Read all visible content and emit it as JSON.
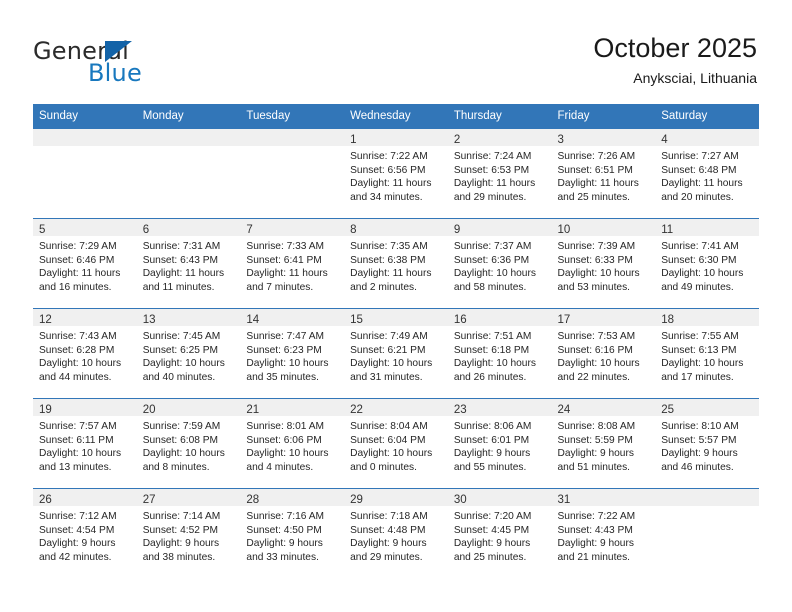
{
  "brand": {
    "name_top": "General",
    "name_bottom": "Blue",
    "accent_color": "#1878be",
    "triangle_color": "#1363a8"
  },
  "header": {
    "title": "October 2025",
    "subtitle": "Anyksciai, Lithuania"
  },
  "calendar": {
    "header_color": "#3276b8",
    "weekday_headers": [
      "Sunday",
      "Monday",
      "Tuesday",
      "Wednesday",
      "Thursday",
      "Friday",
      "Saturday"
    ],
    "labels": {
      "sunrise": "Sunrise:",
      "sunset": "Sunset:",
      "daylight": "Daylight:"
    },
    "weeks": [
      [
        {
          "day": "",
          "sunrise": "",
          "sunset": "",
          "daylight": ""
        },
        {
          "day": "",
          "sunrise": "",
          "sunset": "",
          "daylight": ""
        },
        {
          "day": "",
          "sunrise": "",
          "sunset": "",
          "daylight": ""
        },
        {
          "day": "1",
          "sunrise": "Sunrise: 7:22 AM",
          "sunset": "Sunset: 6:56 PM",
          "daylight": "Daylight: 11 hours and 34 minutes."
        },
        {
          "day": "2",
          "sunrise": "Sunrise: 7:24 AM",
          "sunset": "Sunset: 6:53 PM",
          "daylight": "Daylight: 11 hours and 29 minutes."
        },
        {
          "day": "3",
          "sunrise": "Sunrise: 7:26 AM",
          "sunset": "Sunset: 6:51 PM",
          "daylight": "Daylight: 11 hours and 25 minutes."
        },
        {
          "day": "4",
          "sunrise": "Sunrise: 7:27 AM",
          "sunset": "Sunset: 6:48 PM",
          "daylight": "Daylight: 11 hours and 20 minutes."
        }
      ],
      [
        {
          "day": "5",
          "sunrise": "Sunrise: 7:29 AM",
          "sunset": "Sunset: 6:46 PM",
          "daylight": "Daylight: 11 hours and 16 minutes."
        },
        {
          "day": "6",
          "sunrise": "Sunrise: 7:31 AM",
          "sunset": "Sunset: 6:43 PM",
          "daylight": "Daylight: 11 hours and 11 minutes."
        },
        {
          "day": "7",
          "sunrise": "Sunrise: 7:33 AM",
          "sunset": "Sunset: 6:41 PM",
          "daylight": "Daylight: 11 hours and 7 minutes."
        },
        {
          "day": "8",
          "sunrise": "Sunrise: 7:35 AM",
          "sunset": "Sunset: 6:38 PM",
          "daylight": "Daylight: 11 hours and 2 minutes."
        },
        {
          "day": "9",
          "sunrise": "Sunrise: 7:37 AM",
          "sunset": "Sunset: 6:36 PM",
          "daylight": "Daylight: 10 hours and 58 minutes."
        },
        {
          "day": "10",
          "sunrise": "Sunrise: 7:39 AM",
          "sunset": "Sunset: 6:33 PM",
          "daylight": "Daylight: 10 hours and 53 minutes."
        },
        {
          "day": "11",
          "sunrise": "Sunrise: 7:41 AM",
          "sunset": "Sunset: 6:30 PM",
          "daylight": "Daylight: 10 hours and 49 minutes."
        }
      ],
      [
        {
          "day": "12",
          "sunrise": "Sunrise: 7:43 AM",
          "sunset": "Sunset: 6:28 PM",
          "daylight": "Daylight: 10 hours and 44 minutes."
        },
        {
          "day": "13",
          "sunrise": "Sunrise: 7:45 AM",
          "sunset": "Sunset: 6:25 PM",
          "daylight": "Daylight: 10 hours and 40 minutes."
        },
        {
          "day": "14",
          "sunrise": "Sunrise: 7:47 AM",
          "sunset": "Sunset: 6:23 PM",
          "daylight": "Daylight: 10 hours and 35 minutes."
        },
        {
          "day": "15",
          "sunrise": "Sunrise: 7:49 AM",
          "sunset": "Sunset: 6:21 PM",
          "daylight": "Daylight: 10 hours and 31 minutes."
        },
        {
          "day": "16",
          "sunrise": "Sunrise: 7:51 AM",
          "sunset": "Sunset: 6:18 PM",
          "daylight": "Daylight: 10 hours and 26 minutes."
        },
        {
          "day": "17",
          "sunrise": "Sunrise: 7:53 AM",
          "sunset": "Sunset: 6:16 PM",
          "daylight": "Daylight: 10 hours and 22 minutes."
        },
        {
          "day": "18",
          "sunrise": "Sunrise: 7:55 AM",
          "sunset": "Sunset: 6:13 PM",
          "daylight": "Daylight: 10 hours and 17 minutes."
        }
      ],
      [
        {
          "day": "19",
          "sunrise": "Sunrise: 7:57 AM",
          "sunset": "Sunset: 6:11 PM",
          "daylight": "Daylight: 10 hours and 13 minutes."
        },
        {
          "day": "20",
          "sunrise": "Sunrise: 7:59 AM",
          "sunset": "Sunset: 6:08 PM",
          "daylight": "Daylight: 10 hours and 8 minutes."
        },
        {
          "day": "21",
          "sunrise": "Sunrise: 8:01 AM",
          "sunset": "Sunset: 6:06 PM",
          "daylight": "Daylight: 10 hours and 4 minutes."
        },
        {
          "day": "22",
          "sunrise": "Sunrise: 8:04 AM",
          "sunset": "Sunset: 6:04 PM",
          "daylight": "Daylight: 10 hours and 0 minutes."
        },
        {
          "day": "23",
          "sunrise": "Sunrise: 8:06 AM",
          "sunset": "Sunset: 6:01 PM",
          "daylight": "Daylight: 9 hours and 55 minutes."
        },
        {
          "day": "24",
          "sunrise": "Sunrise: 8:08 AM",
          "sunset": "Sunset: 5:59 PM",
          "daylight": "Daylight: 9 hours and 51 minutes."
        },
        {
          "day": "25",
          "sunrise": "Sunrise: 8:10 AM",
          "sunset": "Sunset: 5:57 PM",
          "daylight": "Daylight: 9 hours and 46 minutes."
        }
      ],
      [
        {
          "day": "26",
          "sunrise": "Sunrise: 7:12 AM",
          "sunset": "Sunset: 4:54 PM",
          "daylight": "Daylight: 9 hours and 42 minutes."
        },
        {
          "day": "27",
          "sunrise": "Sunrise: 7:14 AM",
          "sunset": "Sunset: 4:52 PM",
          "daylight": "Daylight: 9 hours and 38 minutes."
        },
        {
          "day": "28",
          "sunrise": "Sunrise: 7:16 AM",
          "sunset": "Sunset: 4:50 PM",
          "daylight": "Daylight: 9 hours and 33 minutes."
        },
        {
          "day": "29",
          "sunrise": "Sunrise: 7:18 AM",
          "sunset": "Sunset: 4:48 PM",
          "daylight": "Daylight: 9 hours and 29 minutes."
        },
        {
          "day": "30",
          "sunrise": "Sunrise: 7:20 AM",
          "sunset": "Sunset: 4:45 PM",
          "daylight": "Daylight: 9 hours and 25 minutes."
        },
        {
          "day": "31",
          "sunrise": "Sunrise: 7:22 AM",
          "sunset": "Sunset: 4:43 PM",
          "daylight": "Daylight: 9 hours and 21 minutes."
        },
        {
          "day": "",
          "sunrise": "",
          "sunset": "",
          "daylight": ""
        }
      ]
    ]
  }
}
